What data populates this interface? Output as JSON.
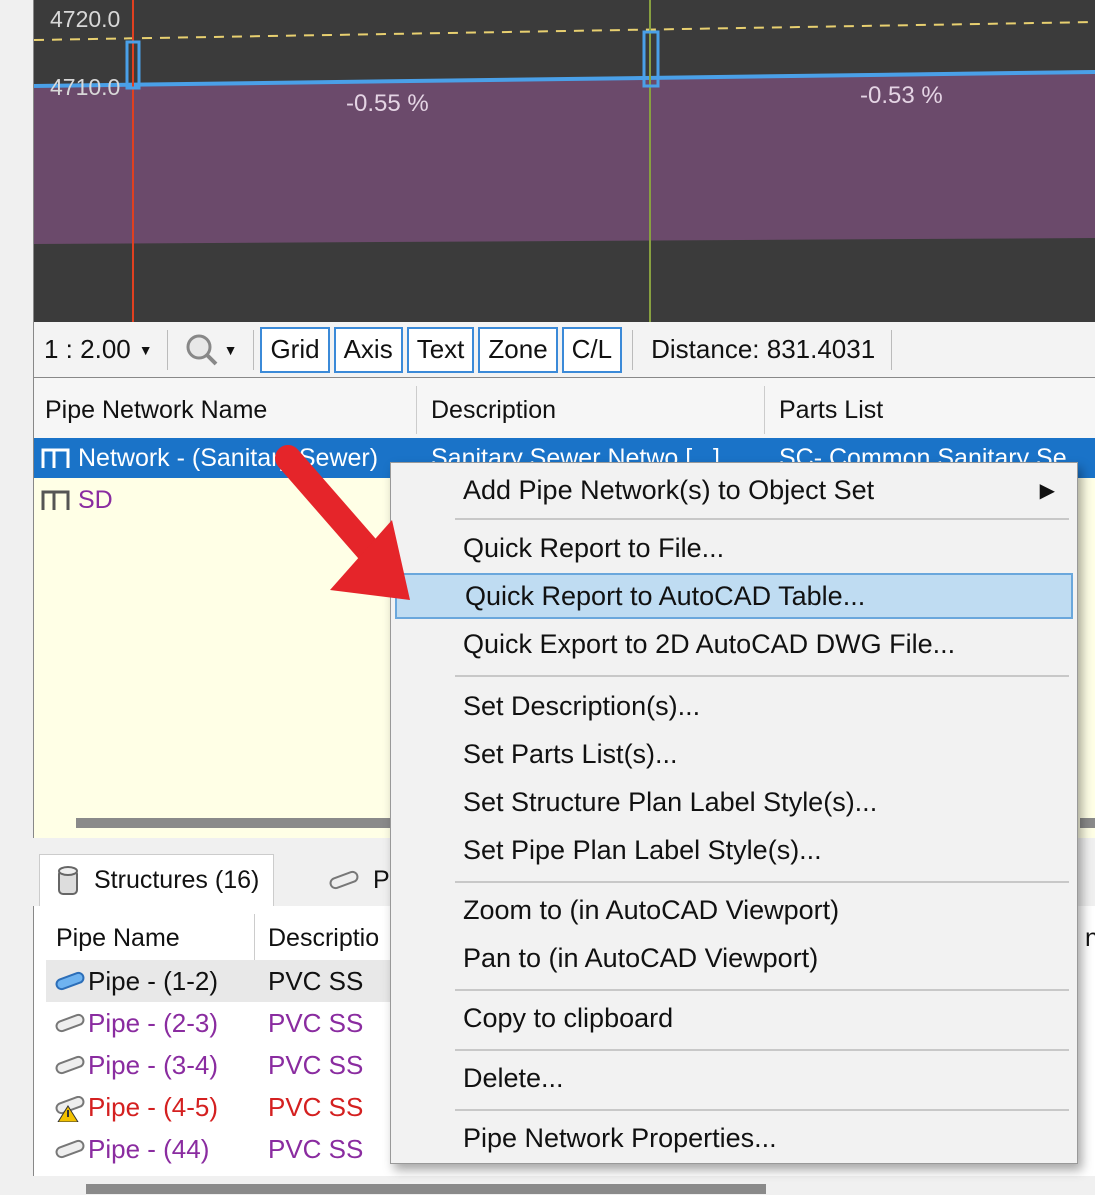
{
  "profile": {
    "elevations": [
      "4720.0",
      "4710.0"
    ],
    "grades": [
      "-0.55 %",
      "-0.53 %"
    ]
  },
  "toolbar": {
    "scale": "1 : 2.00",
    "buttons": [
      "Grid",
      "Axis",
      "Text",
      "Zone",
      "C/L"
    ],
    "distance": "Distance: 831.4031"
  },
  "network_list": {
    "headers": [
      "Pipe Network Name",
      "Description",
      "Parts List"
    ],
    "rows": [
      {
        "name": "Network - (Sanitary Sewer)",
        "description": "Sanitary Sewer Netwo [...]",
        "parts_list": "SC- Common Sanitary Se"
      },
      {
        "name": "SD",
        "description": "",
        "parts_list": ""
      }
    ]
  },
  "tabs": {
    "structures": "Structures (16)",
    "pipes": "P"
  },
  "pipe_table": {
    "headers": [
      "Pipe Name",
      "Descriptio",
      "n"
    ],
    "rows": [
      {
        "name": "Pipe - (1-2)",
        "description": "PVC SS"
      },
      {
        "name": "Pipe - (2-3)",
        "description": "PVC SS"
      },
      {
        "name": "Pipe - (3-4)",
        "description": "PVC SS"
      },
      {
        "name": "Pipe - (4-5)",
        "description": "PVC SS"
      },
      {
        "name": "Pipe - (44)",
        "description": "PVC SS"
      }
    ]
  },
  "context_menu": {
    "items": [
      "Add Pipe Network(s) to Object Set",
      "Quick Report to File...",
      "Quick Report to AutoCAD Table...",
      "Quick Export to 2D AutoCAD DWG File...",
      "Set Description(s)...",
      "Set Parts List(s)...",
      "Set Structure Plan Label Style(s)...",
      "Set Pipe Plan Label Style(s)...",
      "Zoom to (in AutoCAD Viewport)",
      "Pan to (in AutoCAD Viewport)",
      "Copy to clipboard",
      "Delete...",
      "Pipe Network Properties..."
    ],
    "highlighted": "Quick Report to AutoCAD Table..."
  },
  "colors": {
    "selection": "#1a73c8",
    "menu_highlight": "#bfdcf2",
    "arrow": "#e5252a",
    "fill_purple": "#6b4a6b",
    "pipe_line": "#4aa0e8"
  }
}
